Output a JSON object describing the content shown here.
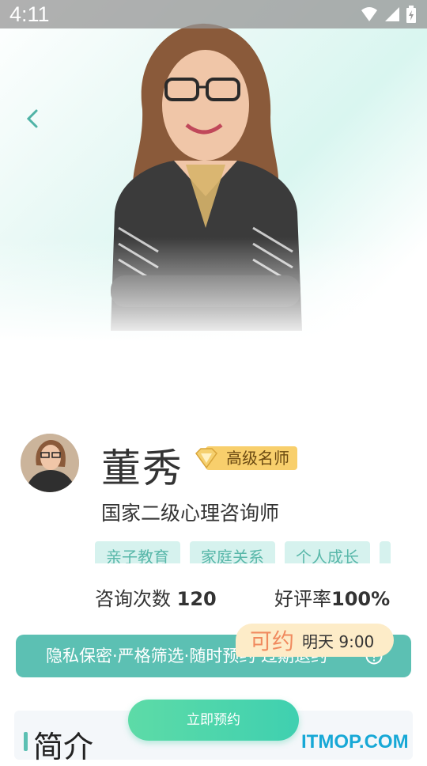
{
  "status_bar": {
    "time": "4:11"
  },
  "profile": {
    "name": "董秀",
    "badge": "高级名师",
    "title": "国家二级心理咨询师",
    "tags": [
      "亲子教育",
      "家庭关系",
      "个人成长"
    ],
    "stats": {
      "consult_label": "咨询次数",
      "consult_value": "120",
      "rating_label": "好评率",
      "rating_value": "100%"
    }
  },
  "privacy_banner": {
    "text": "隐私保密·严格筛选·随时预约·过期退约"
  },
  "availability": {
    "label": "可约",
    "time": "明天 9:00"
  },
  "intro": {
    "title": "简介"
  },
  "book_button": {
    "label": "立即预约"
  },
  "watermark": {
    "text": "ITMOP.COM"
  },
  "colors": {
    "accent": "#5cc0b3",
    "badge": "#f8cf6c",
    "watermark": "#17a8d6"
  }
}
